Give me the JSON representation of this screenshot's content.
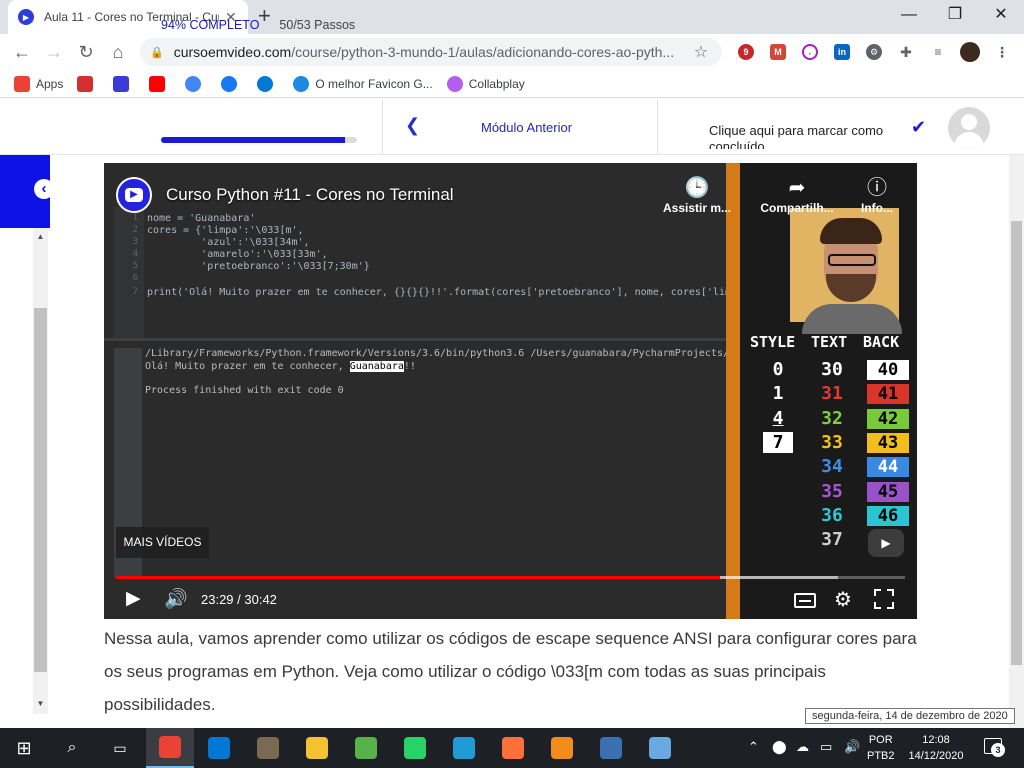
{
  "browser": {
    "tab_title": "Aula 11 - Cores no Terminal - Cur",
    "new_tab": "+",
    "url_domain": "cursoemvideo.com",
    "url_path": "/course/python-3-mundo-1/aulas/adicionando-cores-ao-pyth...",
    "extension_badge": "9",
    "bookmarks": [
      {
        "label": "Apps",
        "color": "#ea4335",
        "icon": "apps-grid-icon"
      },
      {
        "label": "",
        "color": "#d32f2f",
        "icon": "bookmark-icon"
      },
      {
        "label": "",
        "color": "#3b3bd6",
        "icon": "youtube-icon"
      },
      {
        "label": "",
        "color": "#ff0000",
        "icon": "youtube-icon"
      },
      {
        "label": "",
        "color": "#4285f4",
        "icon": "google-icon"
      },
      {
        "label": "",
        "color": "#1877f2",
        "icon": "facebook-icon"
      },
      {
        "label": "",
        "color": "#0078d4",
        "icon": "outlook-icon"
      },
      {
        "label": "O melhor Favicon G...",
        "color": "#1e88e5",
        "icon": "favicon-icon"
      },
      {
        "label": "Collabplay",
        "color": "#b45ef0",
        "icon": "collabplay-icon"
      }
    ]
  },
  "course": {
    "progress_label": "94% COMPLETO",
    "progress_value": 0.94,
    "steps": "50/53 Passos",
    "prev_module": "Módulo Anterior",
    "mark_complete": "Clique aqui para marcar como concluído"
  },
  "video": {
    "title": "Curso Python #11 - Cores no Terminal",
    "watch_later": "Assistir m...",
    "share": "Compartilh...",
    "info": "Info...",
    "more_videos": "MAIS VÍDEOS",
    "time": "23:29 / 30:42",
    "played_fraction": 0.765,
    "buffered_fraction": 0.915,
    "code_lines": [
      {
        "n": "1",
        "text": "nome = 'Guanabara'"
      },
      {
        "n": "2",
        "text": "cores = {'limpa':'\\033[m',"
      },
      {
        "n": "3",
        "text": "         'azul':'\\033[34m',"
      },
      {
        "n": "4",
        "text": "         'amarelo':'\\033[33m',"
      },
      {
        "n": "5",
        "text": "         'pretoebranco':'\\033[7;30m'}"
      },
      {
        "n": "6",
        "text": ""
      },
      {
        "n": "7",
        "text": "print('Olá! Muito prazer em te conhecer, {}{}{}!!'.format(cores['pretoebranco'], nome, cores['limp"
      }
    ],
    "run_path": "/Library/Frameworks/Python.framework/Versions/3.6/bin/python3.6 /Users/guanabara/PycharmProjects/p",
    "run_greeting": "Olá! Muito prazer em te conhecer, ",
    "run_name": "Guanabara",
    "run_end": "!!",
    "run_exit": "Process finished with exit code 0",
    "ansi": {
      "headers": [
        "STYLE",
        "TEXT",
        "BACK"
      ],
      "styles": [
        "0",
        "1",
        "4",
        "7"
      ],
      "text_codes": [
        {
          "code": "30",
          "color": "#ffffff"
        },
        {
          "code": "31",
          "color": "#e23b2e"
        },
        {
          "code": "32",
          "color": "#7bd23a"
        },
        {
          "code": "33",
          "color": "#f2c21b"
        },
        {
          "code": "34",
          "color": "#3d8ee8"
        },
        {
          "code": "35",
          "color": "#a855d8"
        },
        {
          "code": "36",
          "color": "#2dc8d8"
        },
        {
          "code": "37",
          "color": "#cfcfcf"
        }
      ],
      "back_codes": [
        {
          "code": "40",
          "bg": "#ffffff",
          "fg": "#000000"
        },
        {
          "code": "41",
          "bg": "#d8362a",
          "fg": "#000000"
        },
        {
          "code": "42",
          "bg": "#79c93a",
          "fg": "#000000"
        },
        {
          "code": "43",
          "bg": "#f0bf1c",
          "fg": "#000000"
        },
        {
          "code": "44",
          "bg": "#3b88e0",
          "fg": "#ffffff"
        },
        {
          "code": "45",
          "bg": "#9a52c8",
          "fg": "#000000"
        },
        {
          "code": "46",
          "bg": "#2cc4d2",
          "fg": "#000000"
        }
      ]
    }
  },
  "lesson_description": "Nessa aula, vamos aprender como utilizar os códigos de escape sequence ANSI para configurar cores para os seus programas em Python. Veja como utilizar o código \\033[m com todas as suas principais possibilidades.",
  "tooltip": "segunda-feira, 14 de dezembro de 2020",
  "taskbar": {
    "apps": [
      {
        "icon": "chrome-icon",
        "color": "#ea4335",
        "active": true
      },
      {
        "icon": "vscode-icon",
        "color": "#0078d4",
        "active": false
      },
      {
        "icon": "gimp-icon",
        "color": "#7a6a52",
        "active": false
      },
      {
        "icon": "file-explorer-icon",
        "color": "#f2c231",
        "active": false
      },
      {
        "icon": "cube-icon",
        "color": "#55b34a",
        "active": false
      },
      {
        "icon": "whatsapp-icon",
        "color": "#25d366",
        "active": false
      },
      {
        "icon": "edge-icon",
        "color": "#1f9bd6",
        "active": false
      },
      {
        "icon": "firefox-icon",
        "color": "#ff7139",
        "active": false
      },
      {
        "icon": "vlc-icon",
        "color": "#f28c1b",
        "active": false
      },
      {
        "icon": "calculator-icon",
        "color": "#3a6fb0",
        "active": false
      },
      {
        "icon": "paint-icon",
        "color": "#6aa9e0",
        "active": false
      }
    ],
    "language": "POR",
    "keyboard": "PTB2",
    "time": "12:08",
    "date": "14/12/2020",
    "notifications": "3"
  }
}
